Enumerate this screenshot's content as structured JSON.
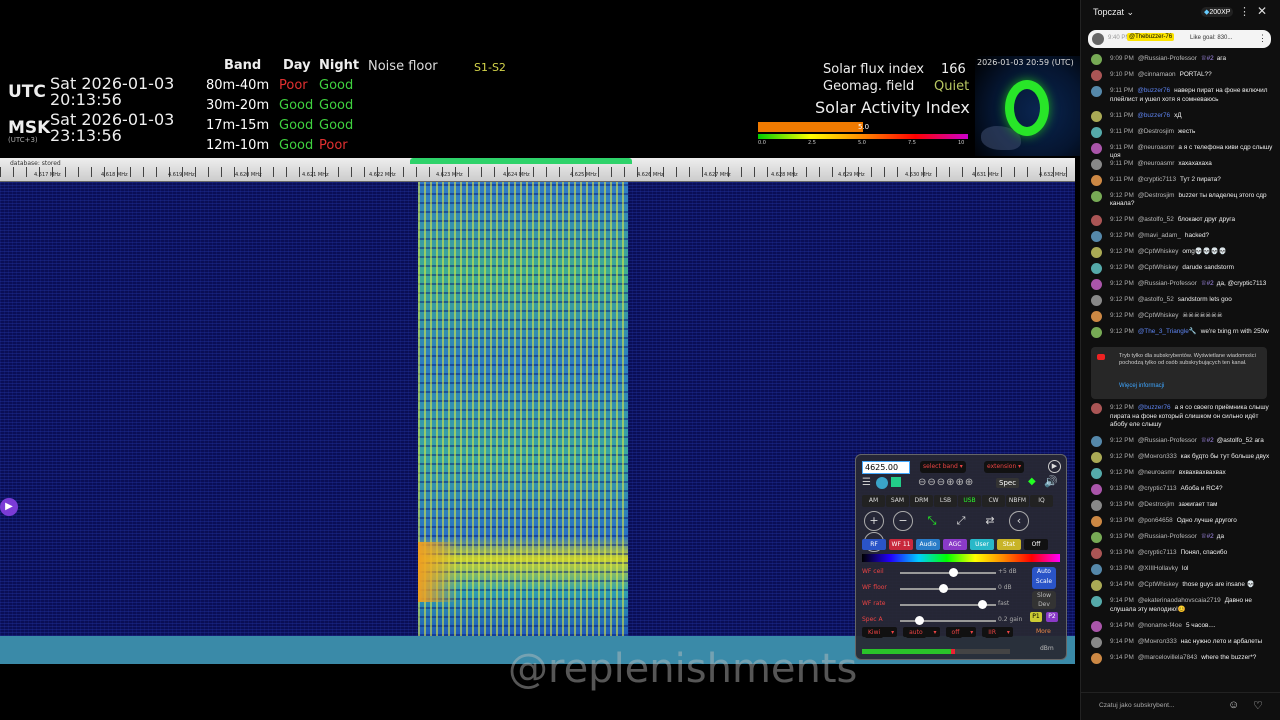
{
  "sdr": {
    "clock": [
      {
        "zone": "UTC",
        "sub": "",
        "date": "Sat 2026-01-03",
        "time": "20:13:56"
      },
      {
        "zone": "MSK",
        "sub": "(UTC+3)",
        "date": "Sat 2026-01-03",
        "time": "23:13:56"
      }
    ],
    "band_table": {
      "headers": {
        "band": "Band",
        "day": "Day",
        "night": "Night"
      },
      "rows": [
        {
          "band": "80m-40m",
          "day": "Poor",
          "night": "Good"
        },
        {
          "band": "30m-20m",
          "day": "Good",
          "night": "Good"
        },
        {
          "band": "17m-15m",
          "day": "Good",
          "night": "Good"
        },
        {
          "band": "12m-10m",
          "day": "Good",
          "night": "Poor"
        }
      ]
    },
    "noise_floor": "Noise floor",
    "s_range": "S1-S2",
    "solar": {
      "flux_label": "Solar flux index",
      "flux_value": "166",
      "geomag_label": "Geomag. field",
      "geomag_value": "Quiet",
      "activity_title": "Solar Activity Index",
      "activity_value": "5.0",
      "activity_level": 0.5,
      "scale_ticks": [
        "0.0",
        "2.5",
        "5.0",
        "7.5",
        "10"
      ]
    },
    "aurora_caption": "2026-01-03 20:59 (UTC)",
    "scale": {
      "db_label": "database: stored",
      "labels": [
        "4.617 MHz",
        "4.618 MHz",
        "4.619 MHz",
        "4.620 MHz",
        "4.621 MHz",
        "4.622 MHz",
        "4.623 MHz",
        "4.624 MHz",
        "4.625 MHz",
        "4.626 MHz",
        "4.627 MHz",
        "4.628 MHz",
        "4.629 MHz",
        "4.630 MHz",
        "4.631 MHz",
        "4.632 MHz"
      ]
    },
    "watermark": "@replenishments",
    "control": {
      "frequency": "4625.00",
      "select_band": "select band",
      "extension": "extension",
      "spec": "Spec",
      "modes": [
        "AM",
        "SAM",
        "DRM",
        "LSB",
        "USB",
        "CW",
        "NBFM",
        "IQ"
      ],
      "active_mode": "USB",
      "tabs": [
        {
          "label": "RF",
          "color": "#2a54c8"
        },
        {
          "label": "WF 11",
          "color": "#c8283c"
        },
        {
          "label": "Audio",
          "color": "#2a7cc8"
        },
        {
          "label": "AGC",
          "color": "#8a3ac8"
        },
        {
          "label": "User",
          "color": "#28b8c8"
        },
        {
          "label": "Stat",
          "color": "#c8b428"
        },
        {
          "label": "Off",
          "color": "#111111"
        }
      ],
      "sliders": [
        {
          "name": "WF ceil",
          "value": "+5 dB",
          "level": 0.55
        },
        {
          "name": "WF floor",
          "value": "0 dB",
          "level": 0.45
        },
        {
          "name": "WF rate",
          "value": "fast",
          "level": 0.85
        },
        {
          "name": "Spec A",
          "value": "0.2 gain",
          "level": 0.2
        }
      ],
      "auto_scale": "Auto Scale",
      "slow_dev": "Slow Dev",
      "p1": "P1",
      "p2": "P2",
      "drops": [
        "Kiwi",
        "auto",
        "off",
        "IIR"
      ],
      "more": "More",
      "dbm": "dBm"
    }
  },
  "chat": {
    "title": "Topczat",
    "xp": "200XP",
    "pinned": {
      "time": "9:40 PM",
      "user": "@Thebuzzer-76",
      "text": "Like goal: 830..."
    },
    "notice": {
      "text": "Tryb tylko dla subskrybentów. Wyświetlane wiadomości pochodzą tylko od osób subskrybujących ten kanał.",
      "more": "Więcej informacji"
    },
    "input_placeholder": "Czatuj jako subskrybent...",
    "messages": [
      {
        "time": "9:09 PM",
        "user": "@Russian-Professor",
        "badge": "♕#2",
        "text": "ага"
      },
      {
        "time": "9:10 PM",
        "user": "@cinnamaon",
        "badge": "",
        "text": "PORTAL??"
      },
      {
        "time": "9:11 PM",
        "user": "@buzzer76",
        "badge": "",
        "text": "наверн пират на фоне включил плейлист и ушел хотя я сомневаюсь",
        "mod": true
      },
      {
        "time": "9:11 PM",
        "user": "@buzzer76",
        "badge": "",
        "text": "хД",
        "mod": true
      },
      {
        "time": "9:11 PM",
        "user": "@Destrosjim",
        "badge": "",
        "text": "жесть"
      },
      {
        "time": "9:11 PM",
        "user": "@neuroasmr",
        "badge": "",
        "text": "а я с телефона киви сдр слышу цоя"
      },
      {
        "time": "9:11 PM",
        "user": "@neuroasmr",
        "badge": "",
        "text": "хахахахаха"
      },
      {
        "time": "9:11 PM",
        "user": "@cryptic7113",
        "badge": "",
        "text": "Тут 2 пирата?"
      },
      {
        "time": "9:12 PM",
        "user": "@Destrosjim",
        "badge": "",
        "text": "buzzer ты владелец этого сдр канала?"
      },
      {
        "time": "9:12 PM",
        "user": "@astolfo_52",
        "badge": "",
        "text": "блокают друг друга"
      },
      {
        "time": "9:12 PM",
        "user": "@mavi_adam_",
        "badge": "",
        "text": "hacked?"
      },
      {
        "time": "9:12 PM",
        "user": "@CptWhiskey",
        "badge": "",
        "text": "omg💀💀💀💀"
      },
      {
        "time": "9:12 PM",
        "user": "@CptWhiskey",
        "badge": "",
        "text": "darude sandstorm"
      },
      {
        "time": "9:12 PM",
        "user": "@Russian-Professor",
        "badge": "♕#2",
        "text": "да, @cryptic7113"
      },
      {
        "time": "9:12 PM",
        "user": "@astolfo_52",
        "badge": "",
        "text": "sandstorm lets goo"
      },
      {
        "time": "9:12 PM",
        "user": "@CptWhiskey",
        "badge": "",
        "text": "☠☠☠☠☠☠☠"
      },
      {
        "time": "9:12 PM",
        "user": "@The_3_Triangle🔧",
        "badge": "",
        "text": "we're txing rn with 250w",
        "mod": true
      },
      {
        "time": "9:12 PM",
        "user": "@buzzer76",
        "badge": "",
        "text": "а я со своего приёмника слышу пирата на фоне который слишком он сильно идёт абобу еле слышу",
        "mod": true
      },
      {
        "time": "9:12 PM",
        "user": "@Russian-Professor",
        "badge": "♕#2",
        "text": "@astolfo_52 ага"
      },
      {
        "time": "9:12 PM",
        "user": "@Монгол333",
        "badge": "",
        "text": "как будто бы тут больше двух"
      },
      {
        "time": "9:12 PM",
        "user": "@neuroasmr",
        "badge": "",
        "text": "вхвахвахвахвах"
      },
      {
        "time": "9:13 PM",
        "user": "@cryptic7113",
        "badge": "",
        "text": "Абоба и RC4?"
      },
      {
        "time": "9:13 PM",
        "user": "@Destrosjim",
        "badge": "",
        "text": "зажигает там"
      },
      {
        "time": "9:13 PM",
        "user": "@pon64658",
        "badge": "",
        "text": "Одно лучше другого"
      },
      {
        "time": "9:13 PM",
        "user": "@Russian-Professor",
        "badge": "♕#2",
        "text": "да"
      },
      {
        "time": "9:13 PM",
        "user": "@cryptic7113",
        "badge": "",
        "text": "Понял, спасибо"
      },
      {
        "time": "9:13 PM",
        "user": "@XIIIHollavky",
        "badge": "",
        "text": "lol"
      },
      {
        "time": "9:14 PM",
        "user": "@CptWhiskey",
        "badge": "",
        "text": "those guys are insane 💀"
      },
      {
        "time": "9:14 PM",
        "user": "@ekaterinaodahovscaia2719",
        "badge": "",
        "text": "Давно не слушала эту мелодию!😊"
      },
      {
        "time": "9:14 PM",
        "user": "@noname-f4oe",
        "badge": "",
        "text": "5 часов...."
      },
      {
        "time": "9:14 PM",
        "user": "@Монгол333",
        "badge": "",
        "text": "нас нужно лето и арбалеты"
      },
      {
        "time": "9:14 PM",
        "user": "@marcelovillela7843",
        "badge": "",
        "text": "where the buzzer*?"
      }
    ]
  }
}
